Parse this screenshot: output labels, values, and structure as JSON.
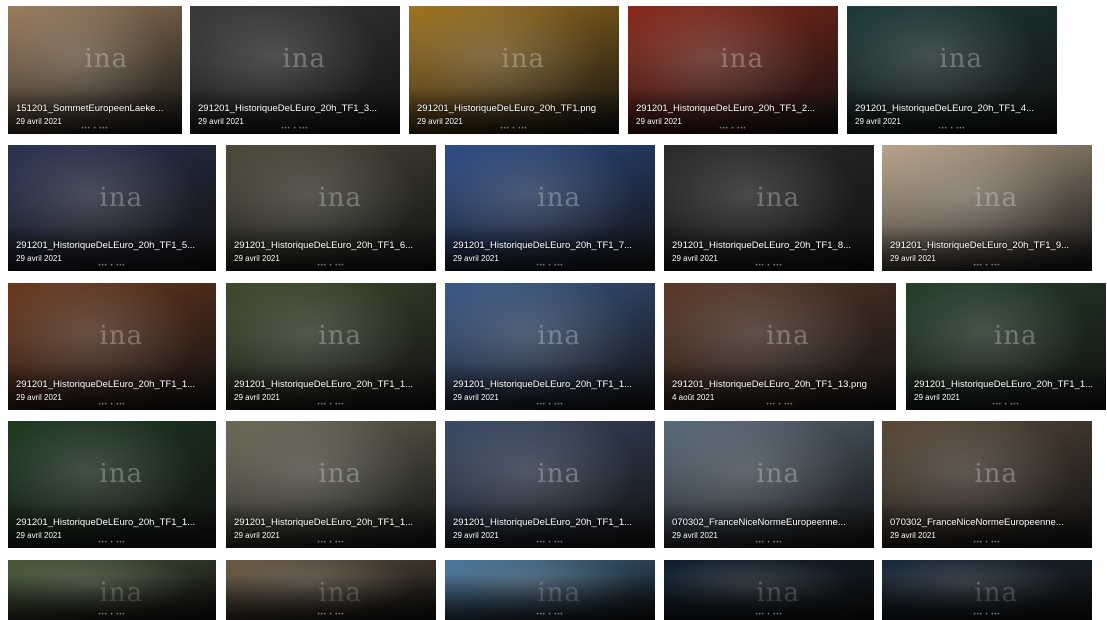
{
  "watermark": "ina",
  "tiles": [
    {
      "name": "151201_SommetEuropeenLaeke...",
      "date": "29 avril 2021",
      "bg": "#9a7d5e"
    },
    {
      "name": "291201_HistoriqueDeLEuro_20h_TF1_3...",
      "date": "29 avril 2021",
      "bg": "#3a3a3a"
    },
    {
      "name": "291201_HistoriqueDeLEuro_20h_TF1.png",
      "date": "29 avril 2021",
      "bg": "#a07420"
    },
    {
      "name": "291201_HistoriqueDeLEuro_20h_TF1_2...",
      "date": "29 avril 2021",
      "bg": "#8a2a1c"
    },
    {
      "name": "291201_HistoriqueDeLEuro_20h_TF1_4...",
      "date": "29 avril 2021",
      "bg": "#1f3a3a"
    },
    {
      "name": "291201_HistoriqueDeLEuro_20h_TF1_5...",
      "date": "29 avril 2021",
      "bg": "#2b3350"
    },
    {
      "name": "291201_HistoriqueDeLEuro_20h_TF1_6...",
      "date": "29 avril 2021",
      "bg": "#4c4a3a"
    },
    {
      "name": "291201_HistoriqueDeLEuro_20h_TF1_7...",
      "date": "29 avril 2021",
      "bg": "#2e4c86"
    },
    {
      "name": "291201_HistoriqueDeLEuro_20h_TF1_8...",
      "date": "29 avril 2021",
      "bg": "#2c2c2c"
    },
    {
      "name": "291201_HistoriqueDeLEuro_20h_TF1_9...",
      "date": "29 avril 2021",
      "bg": "#b9a58d"
    },
    {
      "name": "291201_HistoriqueDeLEuro_20h_TF1_1...",
      "date": "29 avril 2021",
      "bg": "#6b3a20"
    },
    {
      "name": "291201_HistoriqueDeLEuro_20h_TF1_1...",
      "date": "29 avril 2021",
      "bg": "#3f4a2e"
    },
    {
      "name": "291201_HistoriqueDeLEuro_20h_TF1_1...",
      "date": "29 avril 2021",
      "bg": "#3c5a88"
    },
    {
      "name": "291201_HistoriqueDeLEuro_20h_TF1_13.png",
      "date": "4 août 2021",
      "bg": "#5a3a2a"
    },
    {
      "name": "291201_HistoriqueDeLEuro_20h_TF1_1...",
      "date": "29 avril 2021",
      "bg": "#26402a"
    },
    {
      "name": "291201_HistoriqueDeLEuro_20h_TF1_1...",
      "date": "29 avril 2021",
      "bg": "#1e3a20"
    },
    {
      "name": "291201_HistoriqueDeLEuro_20h_TF1_1...",
      "date": "29 avril 2021",
      "bg": "#6c6a58"
    },
    {
      "name": "291201_HistoriqueDeLEuro_20h_TF1_1...",
      "date": "29 avril 2021",
      "bg": "#3a4a66"
    },
    {
      "name": "070302_FranceNiceNormeEuropeenne...",
      "date": "29 avril 2021",
      "bg": "#5a6a7a"
    },
    {
      "name": "070302_FranceNiceNormeEuropeenne...",
      "date": "29 avril 2021",
      "bg": "#5a4a3a"
    },
    {
      "name": "",
      "date": "",
      "bg": "#4a5a3a"
    },
    {
      "name": "",
      "date": "",
      "bg": "#6a5a44"
    },
    {
      "name": "",
      "date": "",
      "bg": "#4a7aa0"
    },
    {
      "name": "",
      "date": "",
      "bg": "#102030"
    },
    {
      "name": "",
      "date": "",
      "bg": "#1a2a3a"
    }
  ]
}
